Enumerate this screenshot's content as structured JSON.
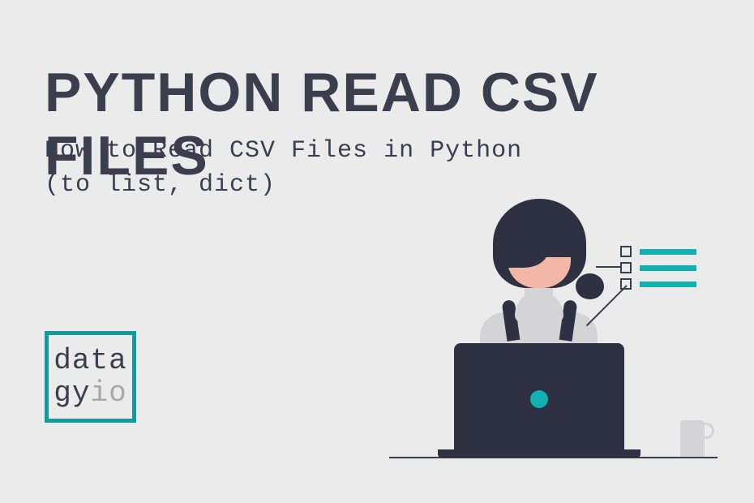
{
  "title": "PYTHON READ CSV FILES",
  "subtitle_line1": "How to Read CSV Files in Python",
  "subtitle_line2": "(to list, dict)",
  "logo": {
    "line1": "data",
    "line2_dark": "gy",
    "line2_gray": "io"
  }
}
